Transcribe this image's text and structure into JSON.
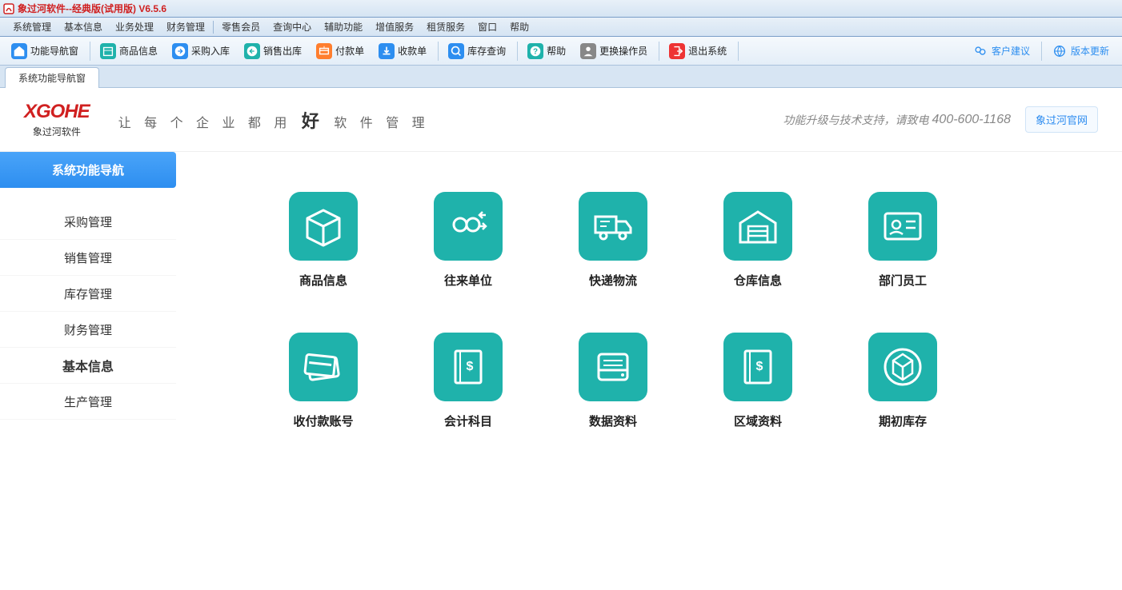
{
  "window": {
    "title": "象过河软件--经典版(试用版) V6.5.6"
  },
  "menubar": [
    "系统管理",
    "基本信息",
    "业务处理",
    "财务管理",
    "|",
    "零售会员",
    "查询中心",
    "辅助功能",
    "增值服务",
    "租赁服务",
    "窗口",
    "帮助"
  ],
  "toolbar_left": [
    {
      "id": "nav",
      "label": "功能导航窗",
      "icon": "home",
      "bg": "#2d8ef0"
    },
    {
      "id": "goods",
      "label": "商品信息",
      "icon": "box",
      "bg": "#1fb2ab"
    },
    {
      "id": "purchase",
      "label": "采购入库",
      "icon": "arrow-in",
      "bg": "#2d8ef0"
    },
    {
      "id": "sale",
      "label": "销售出库",
      "icon": "arrow-out",
      "bg": "#1fb2ab"
    },
    {
      "id": "pay",
      "label": "付款单",
      "icon": "pay",
      "bg": "#ff7e2e"
    },
    {
      "id": "receive",
      "label": "收款单",
      "icon": "receive",
      "bg": "#2d8ef0"
    },
    {
      "id": "stock",
      "label": "库存查询",
      "icon": "search",
      "bg": "#2d8ef0"
    },
    {
      "id": "help",
      "label": "帮助",
      "icon": "help",
      "bg": "#1fb2ab"
    },
    {
      "id": "switch",
      "label": "更换操作员",
      "icon": "user",
      "bg": "#888"
    },
    {
      "id": "exit",
      "label": "退出系统",
      "icon": "exit",
      "bg": "#e33"
    }
  ],
  "toolbar_right": [
    {
      "id": "suggest",
      "label": "客户建议",
      "icon": "suggest",
      "bg": "transparent",
      "color": "#2d8ef0"
    },
    {
      "id": "update",
      "label": "版本更新",
      "icon": "globe",
      "bg": "transparent",
      "color": "#2d8ef0"
    }
  ],
  "tab": {
    "label": "系统功能导航窗"
  },
  "logo": {
    "brand": "XGOHE",
    "sub": "象过河软件"
  },
  "slogan": {
    "pre": "让 每 个 企 业 都 用",
    "big": "好",
    "post": "软 件 管 理"
  },
  "support": {
    "text": "功能升级与技术支持，请致电",
    "phone": "400-600-1168",
    "link": "象过河官网"
  },
  "sidenav": [
    {
      "label": "系统功能导航",
      "state": "active-blue"
    },
    {
      "label": "采购管理",
      "state": ""
    },
    {
      "label": "销售管理",
      "state": ""
    },
    {
      "label": "库存管理",
      "state": ""
    },
    {
      "label": "财务管理",
      "state": ""
    },
    {
      "label": "基本信息",
      "state": "active-white"
    },
    {
      "label": "生产管理",
      "state": ""
    }
  ],
  "grid": [
    {
      "label": "商品信息",
      "icon": "cube"
    },
    {
      "label": "往来单位",
      "icon": "people"
    },
    {
      "label": "快递物流",
      "icon": "truck"
    },
    {
      "label": "仓库信息",
      "icon": "warehouse"
    },
    {
      "label": "部门员工",
      "icon": "idcard"
    },
    {
      "label": "收付款账号",
      "icon": "card"
    },
    {
      "label": "会计科目",
      "icon": "book"
    },
    {
      "label": "数据资料",
      "icon": "disk"
    },
    {
      "label": "区域资料",
      "icon": "book2"
    },
    {
      "label": "期初库存",
      "icon": "cube2"
    }
  ]
}
